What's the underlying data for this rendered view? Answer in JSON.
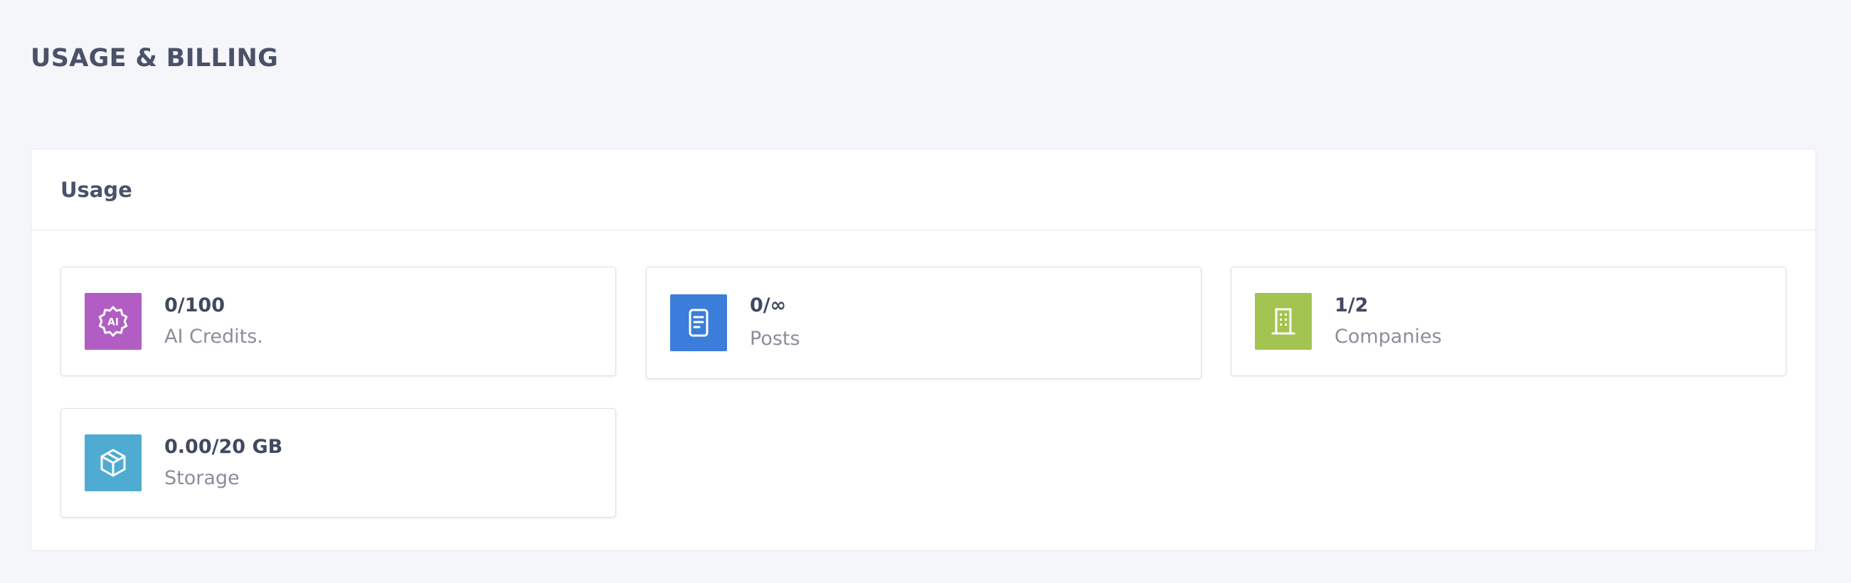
{
  "page": {
    "title": "USAGE & BILLING"
  },
  "usage": {
    "title": "Usage",
    "cards": [
      {
        "value": "0/100",
        "label": "AI Credits.",
        "icon": "ai-badge-icon",
        "color": "#b15dc4"
      },
      {
        "value": "0/∞",
        "label": "Posts",
        "icon": "document-icon",
        "color": "#3b7ddb"
      },
      {
        "value": "1/2",
        "label": "Companies",
        "icon": "building-icon",
        "color": "#a3c451"
      },
      {
        "value": "0.00/20 GB",
        "label": "Storage",
        "icon": "box-icon",
        "color": "#4fabd1"
      }
    ]
  }
}
